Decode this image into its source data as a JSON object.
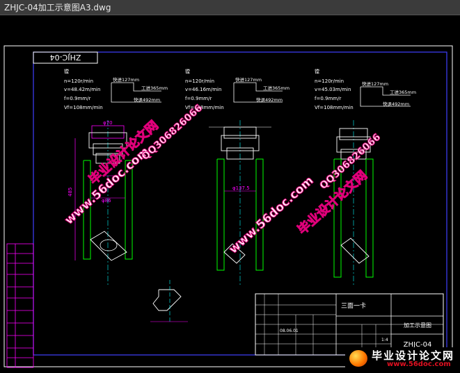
{
  "window": {
    "title": "ZHJC-04加工示意图A3.dwg"
  },
  "border_label": "ZHJC-04",
  "steps": [
    {
      "id": "step1",
      "heading": "镗",
      "params": [
        "n=120r/min",
        "v=48.42m/min",
        "f=0.9mm/r",
        "Vf=108mm/min"
      ],
      "dims": {
        "fast_in": "快进127mm",
        "work": "工进365mm",
        "fast_out": "快退492mm"
      }
    },
    {
      "id": "step2",
      "heading": "镗",
      "params": [
        "n=120r/min",
        "v=46.16m/min",
        "f=0.9mm/r",
        "Vf=108mm/min"
      ],
      "dims": {
        "fast_in": "快进127mm",
        "work": "工进365mm",
        "fast_out": "快退492mm"
      }
    },
    {
      "id": "step3",
      "heading": "镗",
      "params": [
        "n=120r/min",
        "v=45.03m/min",
        "f=0.9mm/r",
        "Vf=108mm/min"
      ],
      "dims": {
        "fast_in": "快进127mm",
        "work": "工进365mm",
        "fast_out": "快退492mm"
      }
    }
  ],
  "part_dims": {
    "d1": "φ70",
    "d2": "φ137.5",
    "d3": "φ86",
    "len": "485"
  },
  "title_block": {
    "station": "三面一卡",
    "drawing_name": "加工示意图",
    "drawing_no": "ZHJC-04",
    "scale": "1:4",
    "date": "08.06.01"
  },
  "watermarks": {
    "url": "www.56doc.com",
    "qq": "QQ306826066",
    "cn": "毕业设计论文网"
  },
  "logo": {
    "cn": "毕业设计论文网",
    "url": "www.56doc.com"
  },
  "colors": {
    "background": "#000000",
    "frame": "#ffffff",
    "border": "#4040ff",
    "dims": "#ff00ff",
    "outline": "#00ff00",
    "centerline": "#00ffff",
    "text": "#ffffff"
  }
}
